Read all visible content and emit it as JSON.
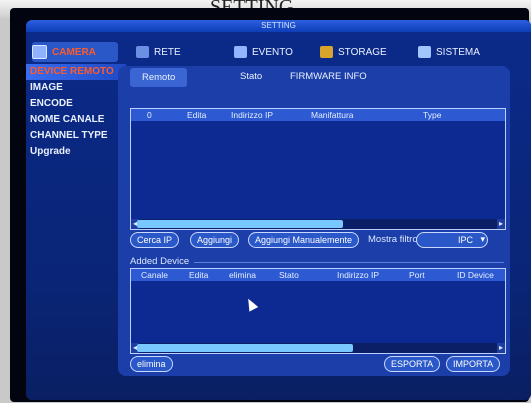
{
  "overlay_text": "SETTING",
  "window_title": "SETTING",
  "top_nav": [
    {
      "label": "CAMERA",
      "icon": "camera-icon",
      "active": true
    },
    {
      "label": "RETE",
      "icon": "network-icon",
      "active": false
    },
    {
      "label": "EVENTO",
      "icon": "event-icon",
      "active": false
    },
    {
      "label": "STORAGE",
      "icon": "storage-icon",
      "active": false
    },
    {
      "label": "SISTEMA",
      "icon": "system-icon",
      "active": false
    }
  ],
  "sidebar": [
    {
      "label": "DEVICE REMOTO",
      "active": true
    },
    {
      "label": "IMAGE",
      "active": false
    },
    {
      "label": "ENCODE",
      "active": false
    },
    {
      "label": "NOME CANALE",
      "active": false
    },
    {
      "label": "CHANNEL TYPE",
      "active": false
    },
    {
      "label": "Upgrade",
      "active": false
    }
  ],
  "subtabs": [
    {
      "label": "Remoto",
      "active": true
    },
    {
      "label": "Stato",
      "active": false
    },
    {
      "label": "FIRMWARE INFO",
      "active": false
    }
  ],
  "search_table": {
    "columns": [
      "0",
      "Edita",
      "Indirizzo IP",
      "Manifattura",
      "Type"
    ],
    "rows": []
  },
  "buttons": {
    "cerca_ip": "Cerca IP",
    "aggiungi": "Aggiungi",
    "aggiungi_manualmente": "Aggiungi Manualemente",
    "elimina": "elimina",
    "esporta": "ESPORTA",
    "importa": "IMPORTA"
  },
  "filter": {
    "label": "Mostra filtro",
    "value": "IPC"
  },
  "added_device": {
    "title": "Added Device",
    "columns": [
      "Canale",
      "Edita",
      "elimina",
      "Stato",
      "Indirizzo IP",
      "Port",
      "ID Device"
    ],
    "rows": []
  }
}
